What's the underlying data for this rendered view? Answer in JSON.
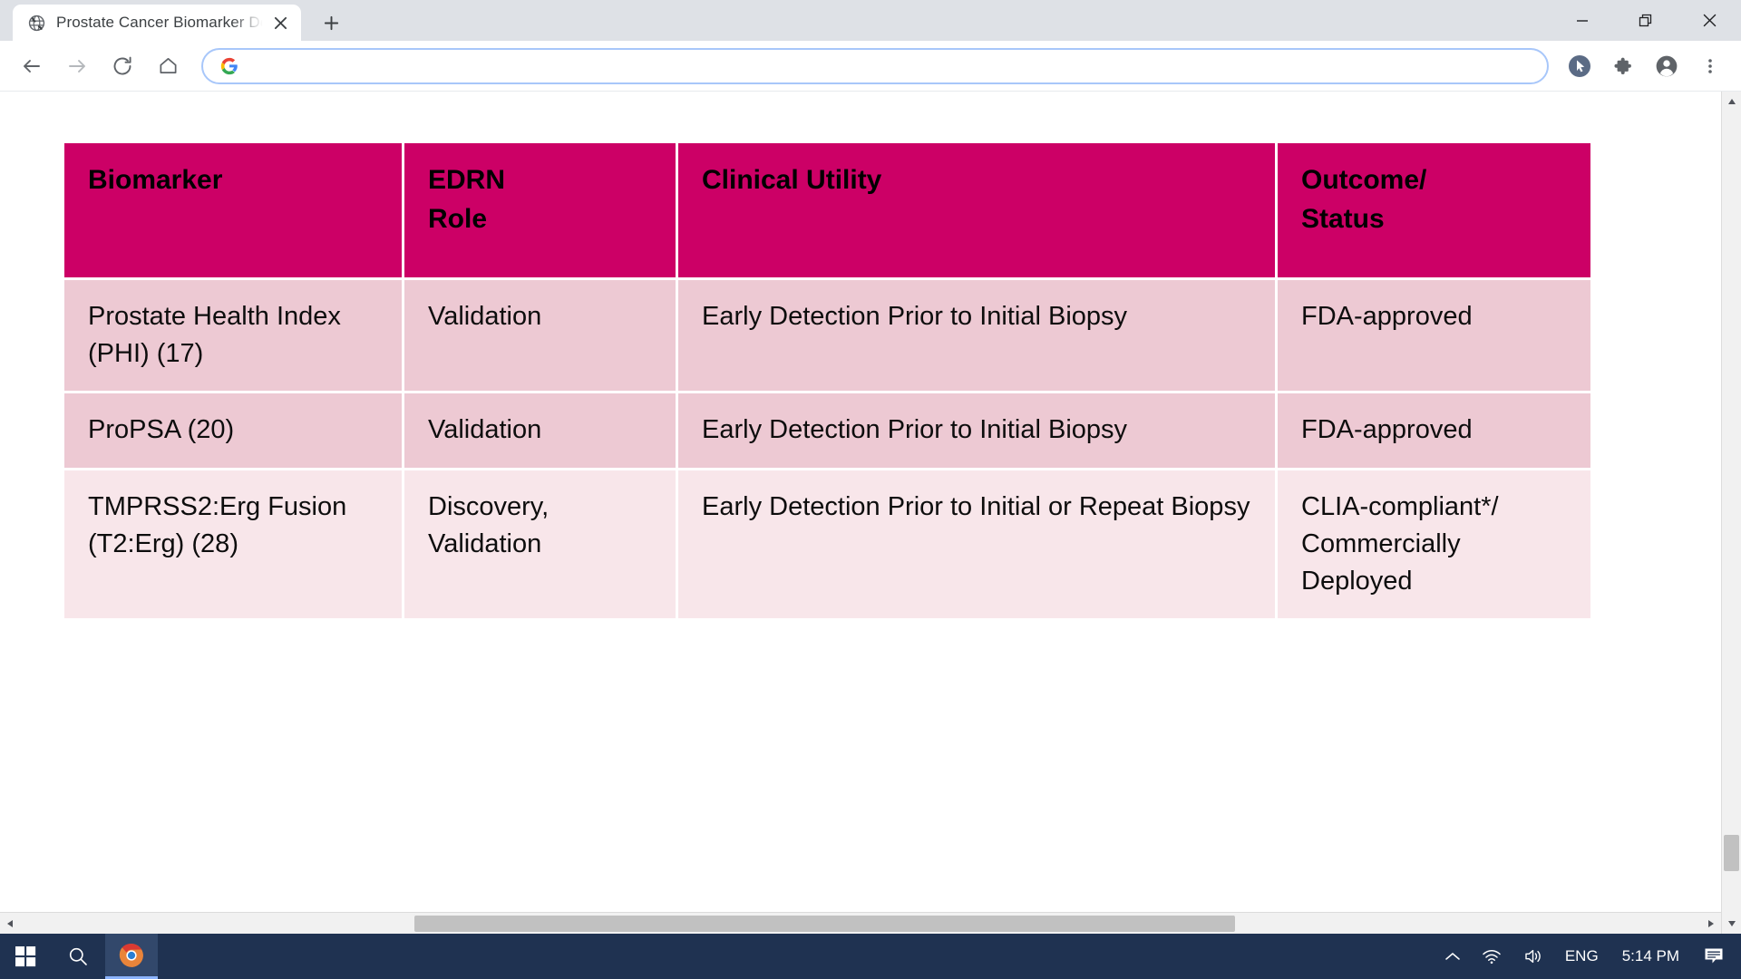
{
  "window": {
    "minimize_label": "Minimize",
    "maximize_label": "Restore",
    "close_label": "Close"
  },
  "tab": {
    "title": "Prostate Cancer Biomarker Devel",
    "favicon": "globe-icon",
    "close_label": "×",
    "new_tab_label": "+"
  },
  "toolbar": {
    "back_label": "Back",
    "forward_label": "Forward",
    "reload_label": "Reload",
    "home_label": "Home",
    "omnibox_value": "",
    "omnibox_placeholder": "",
    "omnibox_icon": "google-g-icon",
    "cursor_icon": "cursor-circle-icon",
    "extensions_icon": "puzzle-piece-icon",
    "profile_icon": "account-avatar-icon",
    "menu_icon": "three-dot-menu-icon"
  },
  "colors": {
    "header_bg": "#CC0066",
    "header_text": "#000000",
    "row_shade": "#EDC9D3",
    "row_light": "#F8E6EA",
    "taskbar_bg": "#1F3251",
    "omnibox_border": "#A8C7FA"
  },
  "table": {
    "headers": [
      "Biomarker",
      "EDRN\nRole",
      "Clinical Utility",
      "Outcome/\nStatus"
    ],
    "rows": [
      {
        "biomarker": "Prostate Health Index (PHI) (17)",
        "role": "Validation",
        "utility": "Early Detection Prior to Initial Biopsy",
        "outcome": "FDA-approved"
      },
      {
        "biomarker": "ProPSA (20)",
        "role": "Validation",
        "utility": "Early Detection Prior to Initial Biopsy",
        "outcome": "FDA-approved"
      },
      {
        "biomarker": "TMPRSS2:Erg Fusion (T2:Erg) (28)",
        "role": "Discovery, Validation",
        "utility": "Early Detection Prior to Initial or Repeat Biopsy",
        "outcome": "CLIA-compliant*/ Commercially Deployed"
      }
    ]
  },
  "scrollbars": {
    "vertical_up_label": "▲",
    "vertical_down_label": "▼",
    "horizontal_left_label": "◀",
    "horizontal_right_label": "▶"
  },
  "taskbar": {
    "start_icon": "windows-logo-icon",
    "search_icon": "search-icon",
    "app_icon": "chrome-icon",
    "show_hidden_icon": "chevron-up-icon",
    "network_icon": "wifi-icon",
    "volume_icon": "speaker-icon",
    "language": "ENG",
    "clock": "5:14 PM",
    "notification_icon": "notification-icon"
  }
}
